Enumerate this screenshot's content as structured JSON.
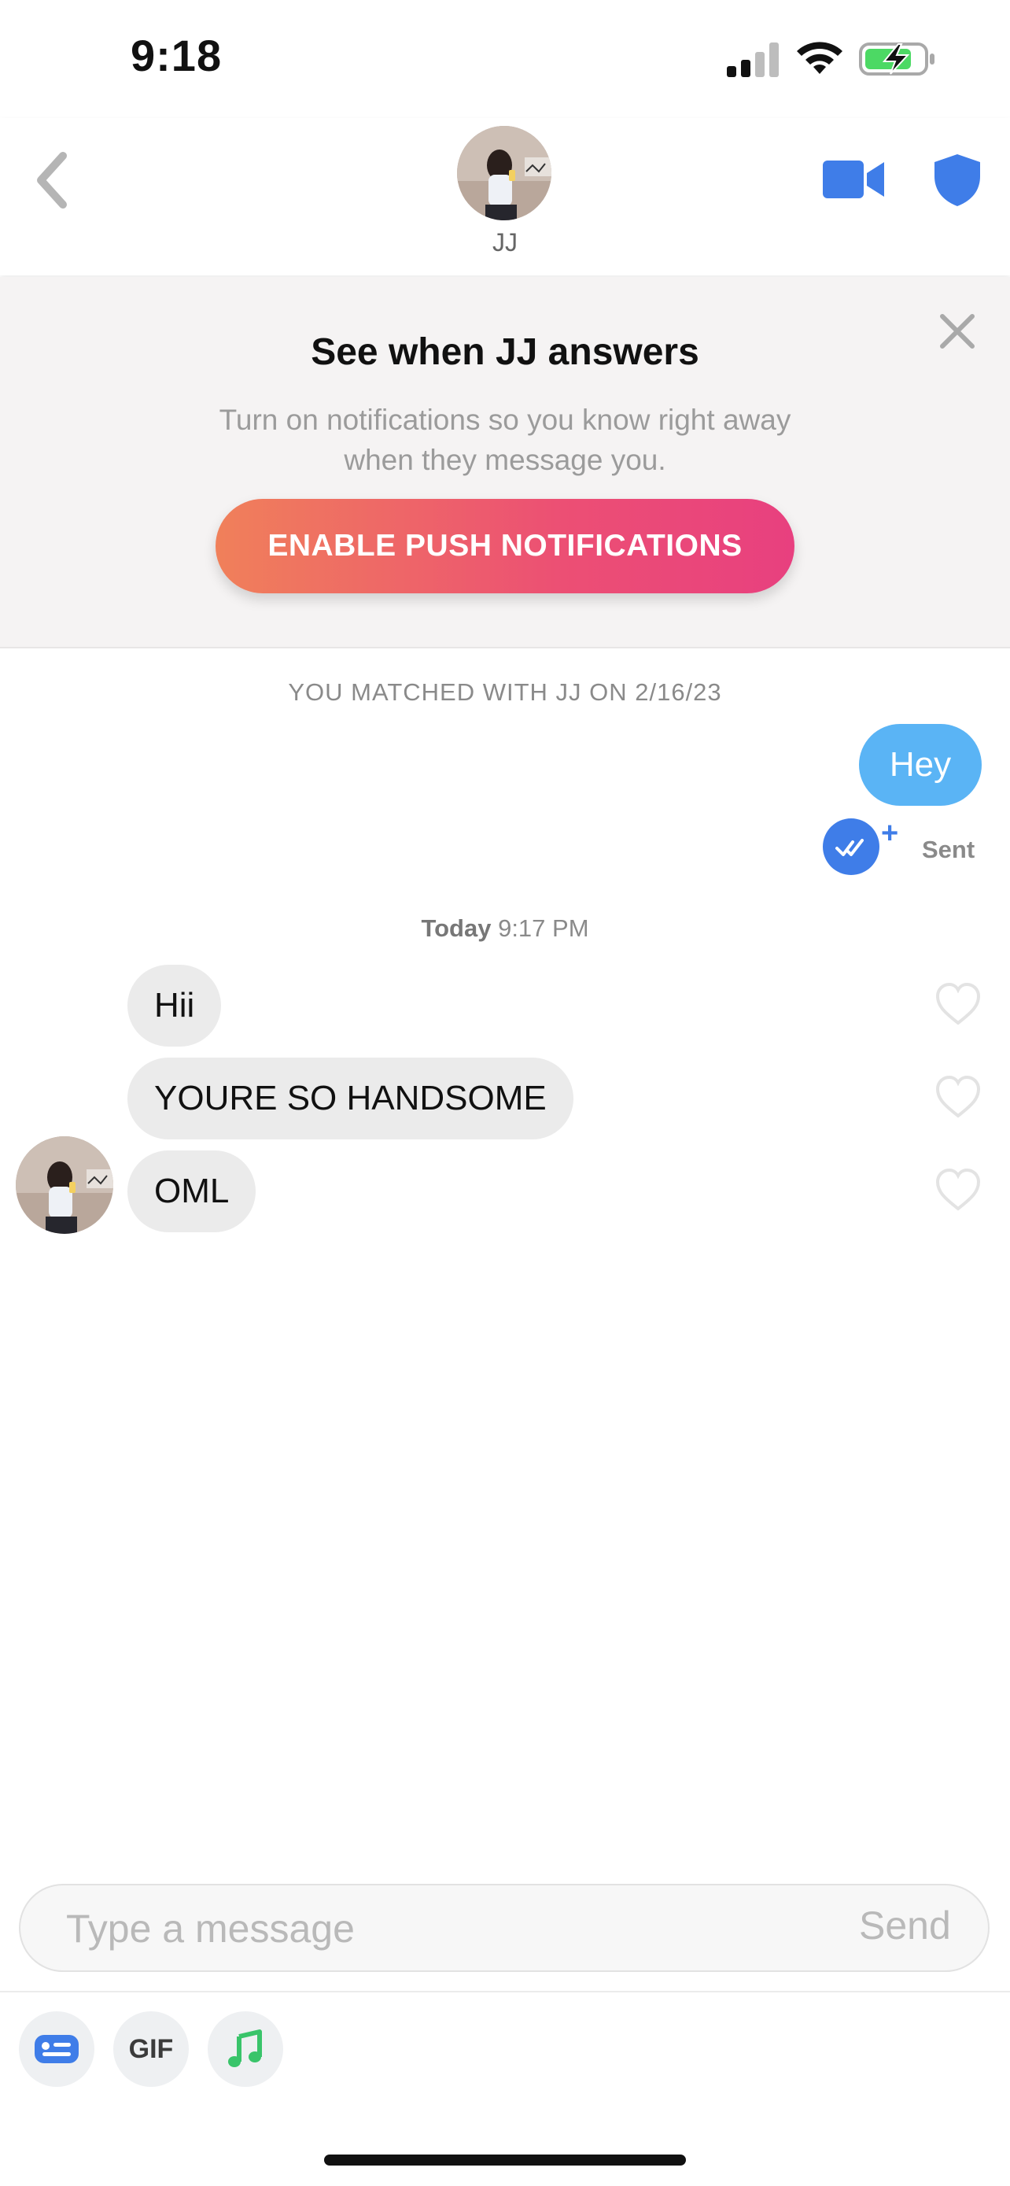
{
  "status_bar": {
    "time": "9:18"
  },
  "header": {
    "name": "JJ"
  },
  "banner": {
    "title": "See when JJ answers",
    "text": "Turn on notifications so you know right away when they message you.",
    "button_label": "ENABLE PUSH NOTIFICATIONS"
  },
  "chat": {
    "matched_label": "YOU MATCHED WITH JJ ON 2/16/23",
    "outgoing": [
      {
        "text": "Hey",
        "status": "Sent"
      }
    ],
    "today_label": {
      "day": "Today",
      "time": "9:17 PM"
    },
    "incoming": [
      {
        "text": "Hii"
      },
      {
        "text": "YOURE SO HANDSOME"
      },
      {
        "text": "OML"
      }
    ]
  },
  "composer": {
    "placeholder": "Type a message",
    "send_label": "Send",
    "gif_label": "GIF"
  },
  "colors": {
    "accent_blue": "#3f7de8",
    "outgoing_bubble": "#5ab4f5",
    "button_gradient_start": "#f0805a",
    "button_gradient_end": "#e8407f"
  }
}
